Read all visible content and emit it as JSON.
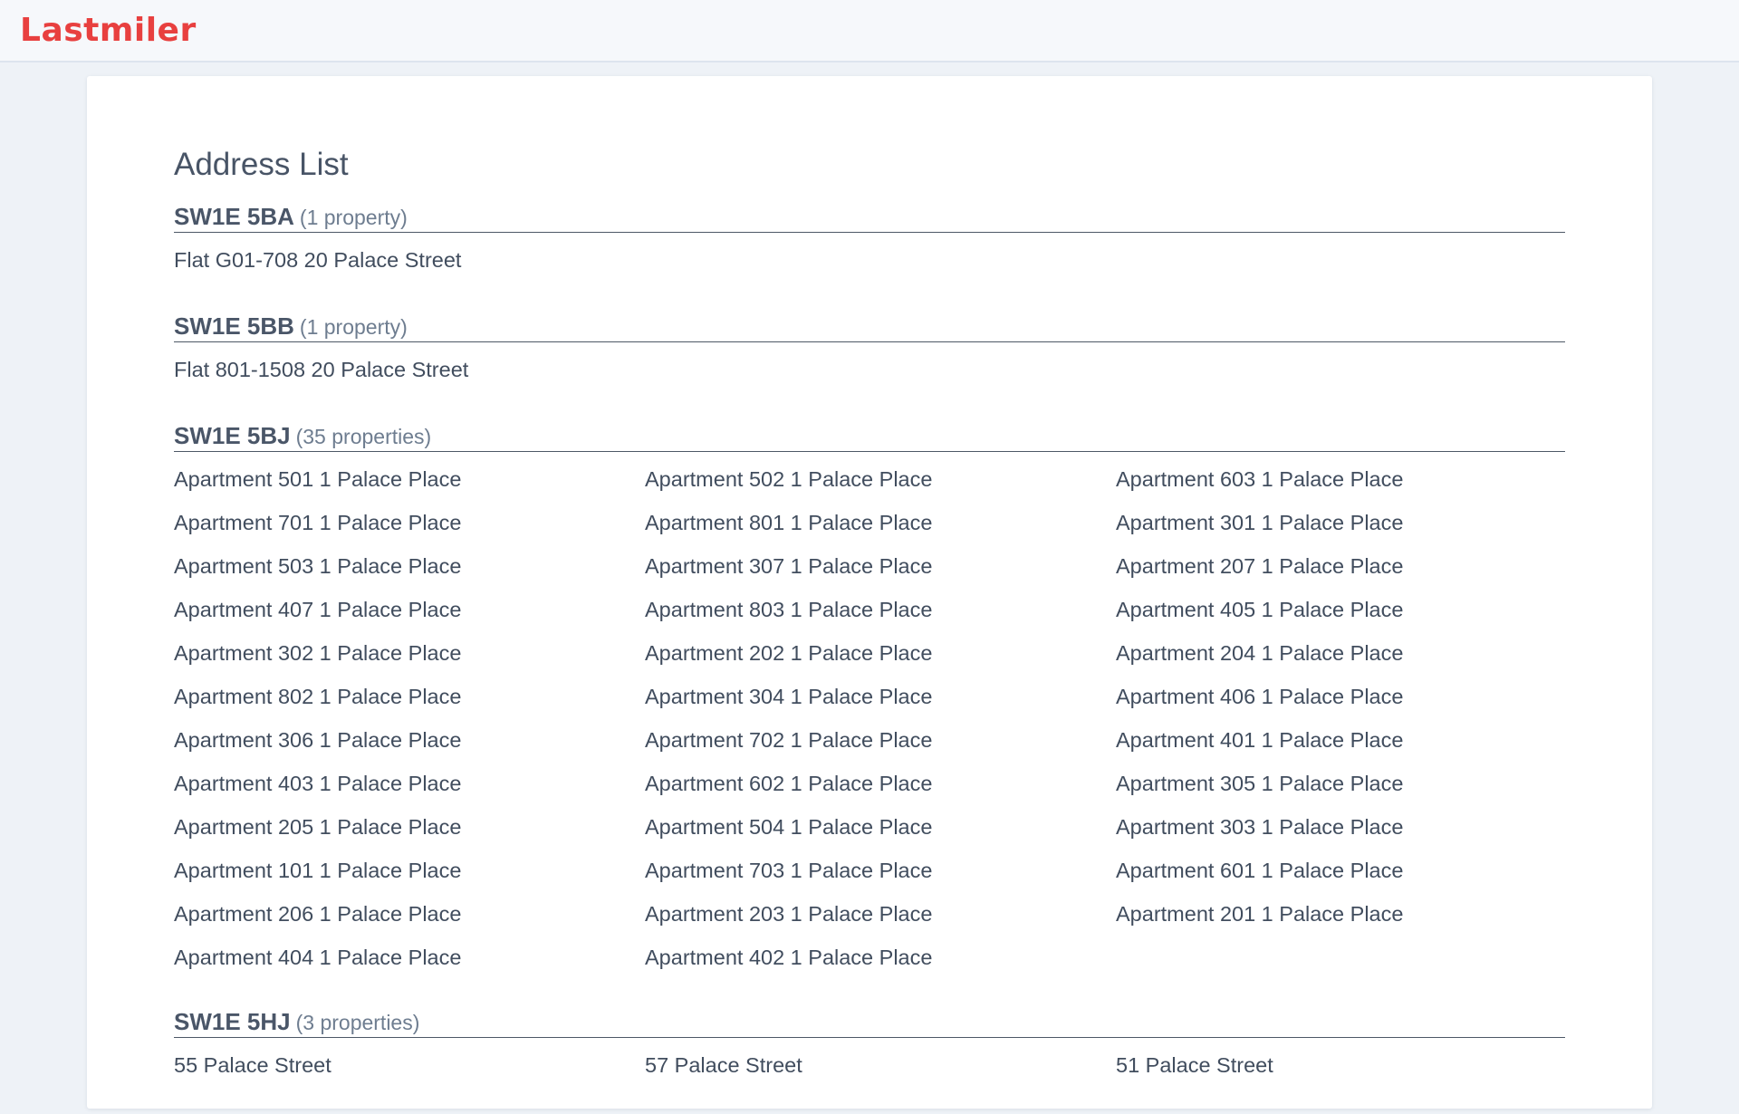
{
  "app": {
    "logo": "Lastmiler"
  },
  "page": {
    "title": "Address List"
  },
  "groups": [
    {
      "postcode": "SW1E 5BA",
      "count_label": "(1 property)",
      "addresses": [
        "Flat G01-708 20 Palace Street"
      ]
    },
    {
      "postcode": "SW1E 5BB",
      "count_label": "(1 property)",
      "addresses": [
        "Flat 801-1508 20 Palace Street"
      ]
    },
    {
      "postcode": "SW1E 5BJ",
      "count_label": "(35 properties)",
      "addresses": [
        "Apartment 501 1 Palace Place",
        "Apartment 502 1 Palace Place",
        "Apartment 603 1 Palace Place",
        "Apartment 701 1 Palace Place",
        "Apartment 801 1 Palace Place",
        "Apartment 301 1 Palace Place",
        "Apartment 503 1 Palace Place",
        "Apartment 307 1 Palace Place",
        "Apartment 207 1 Palace Place",
        "Apartment 407 1 Palace Place",
        "Apartment 803 1 Palace Place",
        "Apartment 405 1 Palace Place",
        "Apartment 302 1 Palace Place",
        "Apartment 202 1 Palace Place",
        "Apartment 204 1 Palace Place",
        "Apartment 802 1 Palace Place",
        "Apartment 304 1 Palace Place",
        "Apartment 406 1 Palace Place",
        "Apartment 306 1 Palace Place",
        "Apartment 702 1 Palace Place",
        "Apartment 401 1 Palace Place",
        "Apartment 403 1 Palace Place",
        "Apartment 602 1 Palace Place",
        "Apartment 305 1 Palace Place",
        "Apartment 205 1 Palace Place",
        "Apartment 504 1 Palace Place",
        "Apartment 303 1 Palace Place",
        "Apartment 101 1 Palace Place",
        "Apartment 703 1 Palace Place",
        "Apartment 601 1 Palace Place",
        "Apartment 206 1 Palace Place",
        "Apartment 203 1 Palace Place",
        "Apartment 201 1 Palace Place",
        "Apartment 404 1 Palace Place",
        "Apartment 402 1 Palace Place"
      ]
    },
    {
      "postcode": "SW1E 5HJ",
      "count_label": "(3 properties)",
      "addresses": [
        "55 Palace Street",
        "57 Palace Street",
        "51 Palace Street"
      ]
    }
  ]
}
